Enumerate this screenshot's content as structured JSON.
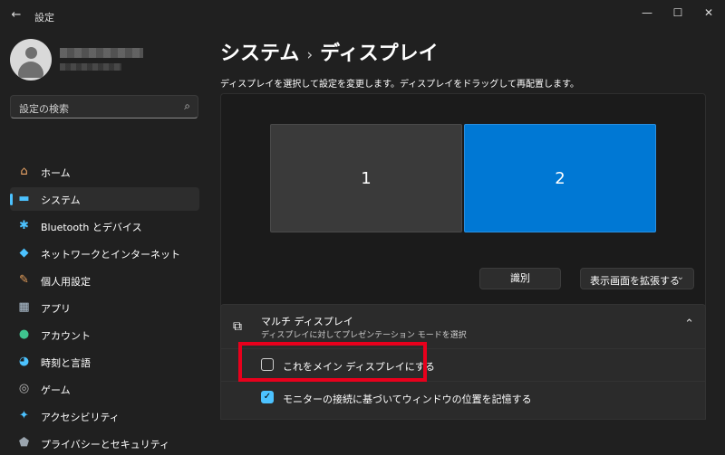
{
  "window": {
    "title": "設定",
    "back_icon": "arrow-left-icon",
    "minimize": "—",
    "maximize": "☐",
    "close": "✕"
  },
  "sidebar": {
    "search_placeholder": "設定の検索",
    "items": [
      {
        "label": "ホーム",
        "icon": "home-icon",
        "glyph": "⌂",
        "color": "#f0a868"
      },
      {
        "label": "システム",
        "icon": "monitor-icon",
        "glyph": "▬",
        "color": "#4cc2ff",
        "selected": true
      },
      {
        "label": "Bluetooth とデバイス",
        "icon": "bluetooth-icon",
        "glyph": "✱",
        "color": "#4cc2ff"
      },
      {
        "label": "ネットワークとインターネット",
        "icon": "wifi-icon",
        "glyph": "◆",
        "color": "#4cc2ff"
      },
      {
        "label": "個人用設定",
        "icon": "brush-icon",
        "glyph": "✎",
        "color": "#e8a05c"
      },
      {
        "label": "アプリ",
        "icon": "apps-icon",
        "glyph": "▦",
        "color": "#b5c7d8"
      },
      {
        "label": "アカウント",
        "icon": "account-icon",
        "glyph": "●",
        "color": "#3fc48f"
      },
      {
        "label": "時刻と言語",
        "icon": "globe-clock-icon",
        "glyph": "◕",
        "color": "#4cc2ff"
      },
      {
        "label": "ゲーム",
        "icon": "gamepad-icon",
        "glyph": "◎",
        "color": "#bbbbbb"
      },
      {
        "label": "アクセシビリティ",
        "icon": "accessibility-icon",
        "glyph": "✦",
        "color": "#4cc2ff"
      },
      {
        "label": "プライバシーとセキュリティ",
        "icon": "shield-icon",
        "glyph": "⬟",
        "color": "#9aa4ad"
      }
    ]
  },
  "content": {
    "breadcrumb_parent": "システム",
    "breadcrumb_sep": "›",
    "breadcrumb_current": "ディスプレイ",
    "description": "ディスプレイを選択して設定を変更します。ディスプレイをドラッグして再配置します。",
    "monitors": [
      {
        "label": "1",
        "color": "#3a3a3a"
      },
      {
        "label": "2",
        "color": "#0078d4"
      }
    ],
    "identify_button": "識別",
    "extend_dropdown": "表示画面を拡張する",
    "multi_display": {
      "title": "マルチ ディスプレイ",
      "subtitle": "ディスプレイに対してプレゼンテーション モードを選択",
      "options": [
        {
          "label": "これをメイン ディスプレイにする",
          "checked": false
        },
        {
          "label": "モニターの接続に基づいてウィンドウの位置を記憶する",
          "checked": true
        }
      ]
    }
  },
  "colors": {
    "accent": "#4cc2ff",
    "highlight": "#e8001c",
    "background": "#202020"
  }
}
